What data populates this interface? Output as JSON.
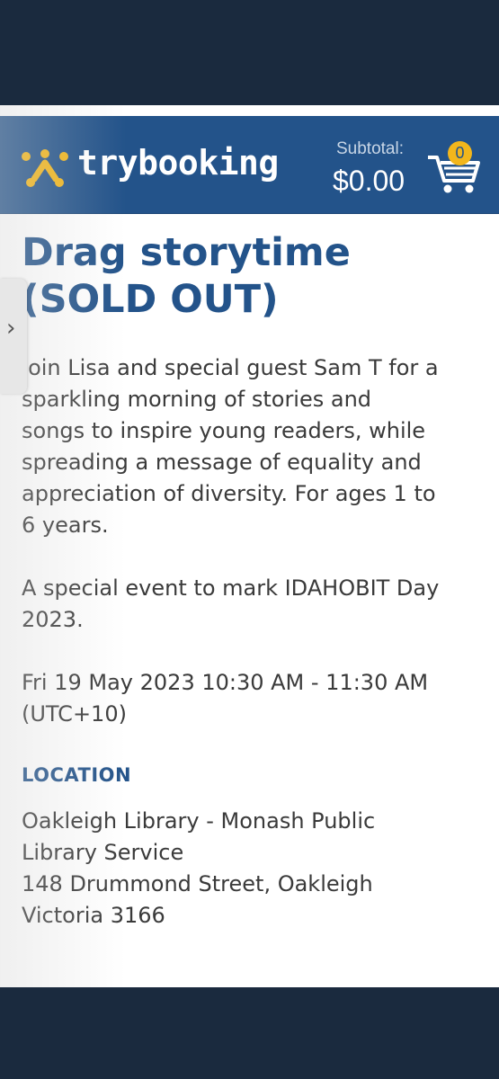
{
  "brand": {
    "name": "trybooking"
  },
  "cart": {
    "subtotal_label": "Subtotal:",
    "subtotal_value": "$0.00",
    "item_count": "0",
    "icon": "shopping-cart-icon"
  },
  "colors": {
    "header": "#23538a",
    "accent": "#f2b61b",
    "heading": "#23538a",
    "text": "#3a3a3a"
  },
  "event": {
    "title_line1": "Drag storytime",
    "title_line2": "(SOLD OUT)",
    "description_lines": [
      "Join Lisa and special guest Sam T for a",
      "sparkling morning of stories and",
      "songs to inspire young readers, while",
      "spreading a message of equality and",
      "appreciation of diversity. For ages 1 to",
      "6 years."
    ],
    "note_lines": [
      "A special event to mark IDAHOBIT Day",
      "2023."
    ],
    "datetime_lines": [
      "Fri 19 May 2023 10:30 AM - 11:30 AM",
      "(UTC+10)"
    ],
    "location_label": "LOCATION",
    "address_lines": [
      "Oakleigh Library - Monash Public",
      "Library Service",
      "148 Drummond Street, Oakleigh",
      "Victoria 3166"
    ]
  },
  "side_tab": {
    "icon": "chevron-right-icon",
    "glyph": "›"
  }
}
